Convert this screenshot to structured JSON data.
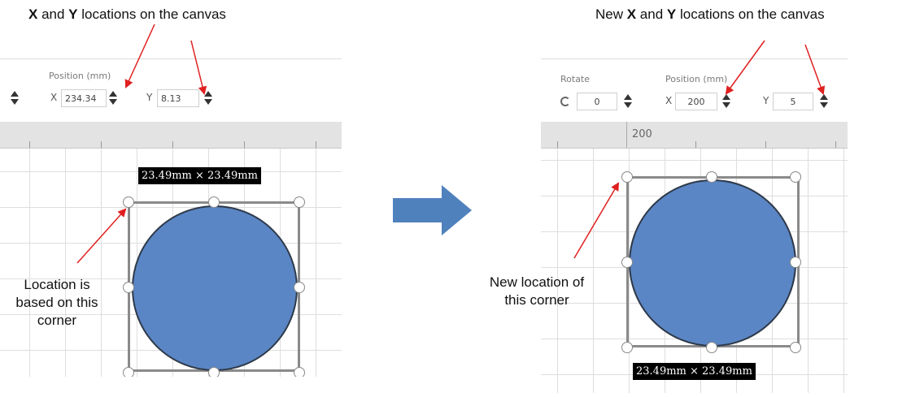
{
  "captions": {
    "left_x": "X",
    "left_and": " and ",
    "left_y": "Y",
    "left_tail": " locations on the canvas",
    "right_new": "New ",
    "right_x": "X",
    "right_and": " and ",
    "right_y": "Y",
    "right_tail": " locations on the canvas"
  },
  "notes": {
    "left": [
      "Location is",
      "based on this",
      "corner"
    ],
    "right": [
      "New location of",
      "this corner"
    ]
  },
  "before": {
    "position_label": "Position (mm)",
    "x_label": "X",
    "x_value": "234.34",
    "y_label": "Y",
    "y_value": "8.13",
    "dimensions": "23.49mm × 23.49mm"
  },
  "after": {
    "rotate_label": "Rotate",
    "rotate_value": "0",
    "position_label": "Position (mm)",
    "x_label": "X",
    "x_value": "200",
    "y_label": "Y",
    "y_value": "5",
    "ruler_number": "200",
    "dimensions": "23.49mm × 23.49mm"
  },
  "colors": {
    "shape_fill": "#5b86c5",
    "arrow": "#e02020",
    "transition_arrow": "#4f81bd"
  }
}
